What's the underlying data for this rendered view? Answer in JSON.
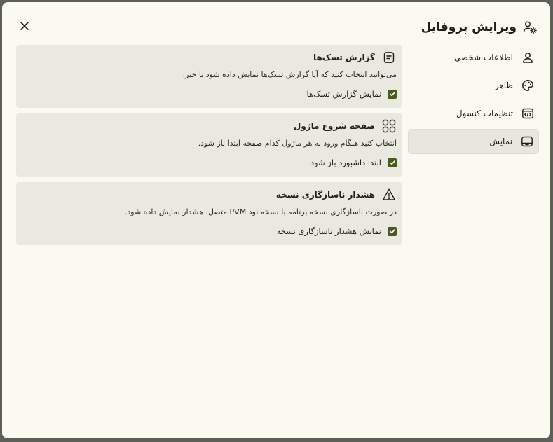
{
  "dialog": {
    "title": "ویرایش پروفایل",
    "title_icon": "user-settings-icon",
    "close_icon": "close-icon"
  },
  "sidebar": {
    "items": [
      {
        "label": "اطلاعات شخصی",
        "icon": "user-icon",
        "active": false
      },
      {
        "label": "ظاهر",
        "icon": "palette-icon",
        "active": false
      },
      {
        "label": "تنظیمات کنسول",
        "icon": "code-window-icon",
        "active": false
      },
      {
        "label": "نمایش",
        "icon": "display-icon",
        "active": true
      }
    ]
  },
  "main": {
    "cards": [
      {
        "title": "گزارش تسک‌ها",
        "icon": "note-icon",
        "description": "می‌توانید انتخاب کنید که آیا گزارش تسک‌ها نمایش داده شود یا خیر.",
        "checkbox_label": "نمایش گزارش تسک‌ها",
        "checked": true
      },
      {
        "title": "صفحه شروع ماژول",
        "icon": "grid-icon",
        "description": "انتخاب کنید هنگام ورود به هر ماژول کدام صفحه ابتدا باز شود.",
        "checkbox_label": "ابتدا داشبورد باز شود",
        "checked": true
      },
      {
        "title": "هشدار ناسازگاری نسخه",
        "icon": "warning-icon",
        "description": "در صورت ناسازگاری نسخه برنامه با نسخه نود PVM متصل، هشدار نمایش داده شود.",
        "checkbox_label": "نمایش هشدار ناسازگاری نسخه",
        "checked": true
      }
    ]
  },
  "colors": {
    "accent": "#4a5a1e",
    "dialog_bg": "#fafaf0",
    "card_bg": "#e9e9df",
    "active_nav_bg": "#e7e7de"
  }
}
